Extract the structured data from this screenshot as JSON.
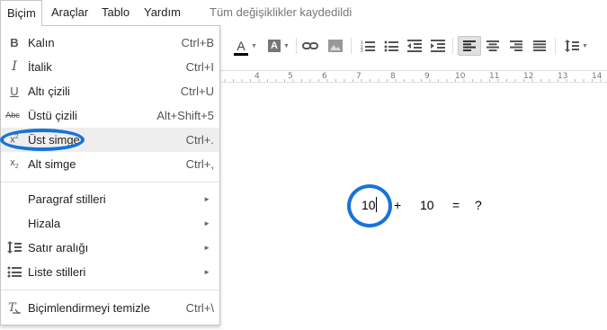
{
  "menubar": {
    "items": [
      "Biçim",
      "Araçlar",
      "Tablo",
      "Yardım"
    ],
    "status": "Tüm değişiklikler kaydedildi"
  },
  "toolbar": {
    "font_color_label": "A",
    "highlight_label": "A"
  },
  "ruler": {
    "numbers": [
      "4",
      "5",
      "6",
      "7",
      "8",
      "9",
      "10",
      "11",
      "12",
      "13",
      "14"
    ]
  },
  "format_menu": {
    "items": [
      {
        "icon": "bold-icon",
        "label": "Kalın",
        "shortcut": "Ctrl+B"
      },
      {
        "icon": "italic-icon",
        "label": "İtalik",
        "shortcut": "Ctrl+I"
      },
      {
        "icon": "underline-icon",
        "label": "Altı çizili",
        "shortcut": "Ctrl+U"
      },
      {
        "icon": "strikethrough-icon",
        "label": "Üstü çizili",
        "shortcut": "Alt+Shift+5"
      },
      {
        "icon": "superscript-icon",
        "label": "Üst simge",
        "shortcut": "Ctrl+.",
        "highlighted": true
      },
      {
        "icon": "subscript-icon",
        "label": "Alt simge",
        "shortcut": "Ctrl+,"
      },
      {
        "label": "Paragraf stilleri",
        "submenu": true
      },
      {
        "label": "Hizala",
        "submenu": true
      },
      {
        "icon": "line-spacing-icon",
        "label": "Satır aralığı",
        "submenu": true
      },
      {
        "icon": "list-icon",
        "label": "Liste stilleri",
        "submenu": true
      },
      {
        "icon": "clear-formatting-icon",
        "label": "Biçimlendirmeyi temizle",
        "shortcut": "Ctrl+\\"
      }
    ],
    "submenu_arrow": "►"
  },
  "document": {
    "tokens": [
      "10",
      "+",
      "10",
      "=",
      "?"
    ]
  },
  "colors": {
    "annotation_circle": "#1673d9",
    "menu_highlight": "#eeeeee",
    "menu_border": "#c6c6c6"
  }
}
